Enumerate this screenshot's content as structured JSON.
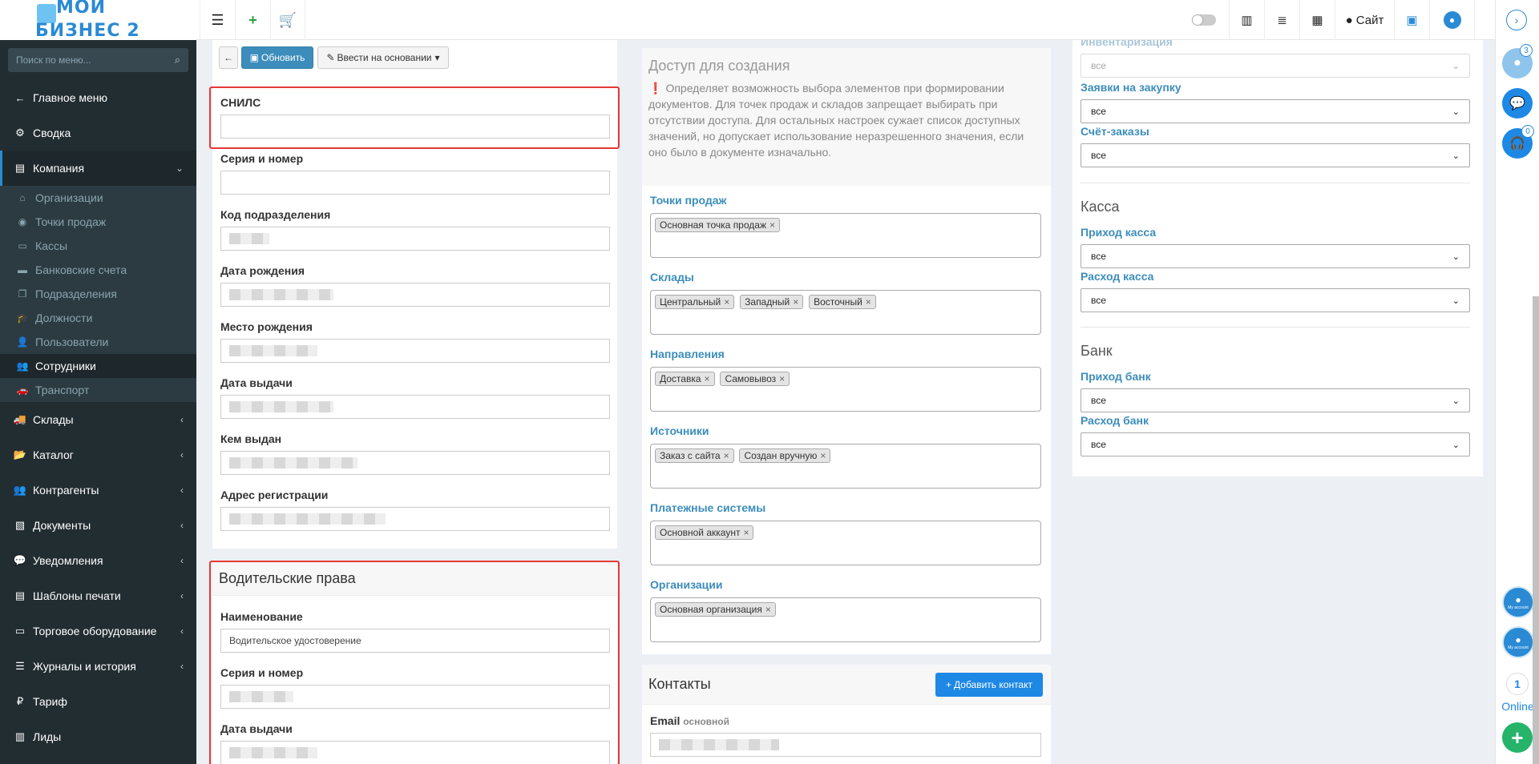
{
  "header": {
    "logo": {
      "line1": "МОЙ",
      "line2": "БИЗНЕС",
      "num": "2"
    },
    "site_label": "Сайт"
  },
  "sidebar": {
    "search_placeholder": "Поиск по меню...",
    "items": [
      {
        "label": "Главное меню",
        "icon": "arrow-left-icon"
      },
      {
        "label": "Сводка",
        "icon": "gear-icon"
      },
      {
        "label": "Компания",
        "icon": "chart-icon"
      },
      {
        "label": "Склады",
        "icon": "truck-icon"
      },
      {
        "label": "Каталог",
        "icon": "folder-icon"
      },
      {
        "label": "Контрагенты",
        "icon": "users-icon"
      },
      {
        "label": "Документы",
        "icon": "document-icon"
      },
      {
        "label": "Уведомления",
        "icon": "chat-icon"
      },
      {
        "label": "Шаблоны печати",
        "icon": "book-icon"
      },
      {
        "label": "Торговое оборудование",
        "icon": "hdd-icon"
      },
      {
        "label": "Журналы и история",
        "icon": "list-icon"
      },
      {
        "label": "Тариф",
        "icon": "ruble-icon"
      },
      {
        "label": "Лиды",
        "icon": "address-book-icon"
      }
    ],
    "company_sub": [
      {
        "label": "Организации",
        "icon": "bank-icon"
      },
      {
        "label": "Точки продаж",
        "icon": "circle-icon"
      },
      {
        "label": "Кассы",
        "icon": "register-icon"
      },
      {
        "label": "Банковские счета",
        "icon": "card-icon"
      },
      {
        "label": "Подразделения",
        "icon": "copy-icon"
      },
      {
        "label": "Должности",
        "icon": "graduation-icon"
      },
      {
        "label": "Пользователи",
        "icon": "user-icon"
      },
      {
        "label": "Сотрудники",
        "icon": "users-icon"
      },
      {
        "label": "Транспорт",
        "icon": "car-icon"
      }
    ]
  },
  "toolbar": {
    "refresh_label": "Обновить",
    "based_on_label": "Ввести на основании"
  },
  "left_panel": {
    "snils_label": "СНИЛС",
    "series_label": "Серия и номер",
    "division_code_label": "Код подразделения",
    "birth_date_label": "Дата рождения",
    "birth_place_label": "Место рождения",
    "issue_date_label": "Дата выдачи",
    "issued_by_label": "Кем выдан",
    "reg_address_label": "Адрес регистрации"
  },
  "license": {
    "title": "Водительские права",
    "name_label": "Наименование",
    "name_value": "Водительское удостоверение",
    "series_label": "Серия и номер",
    "issue_date_label": "Дата выдачи"
  },
  "access": {
    "title": "Доступ для создания",
    "help": "Определяет возможность выбора элементов при формировании документов. Для точек продаж и складов запрещает выбирать при отсутствии доступа. Для остальных настроек сужает список доступных значений, но допускает использование неразрешенного значения, если оно было в документе изначально.",
    "groups": [
      {
        "label": "Точки продаж",
        "tags": [
          "Основная точка продаж"
        ]
      },
      {
        "label": "Склады",
        "tags": [
          "Центральный",
          "Западный",
          "Восточный"
        ]
      },
      {
        "label": "Направления",
        "tags": [
          "Доставка",
          "Самовывоз"
        ]
      },
      {
        "label": "Источники",
        "tags": [
          "Заказ с сайта",
          "Создан вручную"
        ]
      },
      {
        "label": "Платежные системы",
        "tags": [
          "Основной аккаунт"
        ]
      },
      {
        "label": "Организации",
        "tags": [
          "Основная организация"
        ]
      }
    ]
  },
  "contacts": {
    "title": "Контакты",
    "add_label": "Добавить контакт",
    "email_label": "Email",
    "email_sub": "основной"
  },
  "right_panel": {
    "inventory_label": "Инвентаризация",
    "purchase_label": "Заявки на закупку",
    "invoice_label": "Счёт-заказы",
    "cash_title": "Касса",
    "cash_in_label": "Приход касса",
    "cash_out_label": "Расход касса",
    "bank_title": "Банк",
    "bank_in_label": "Приход банк",
    "bank_out_label": "Расход банк",
    "select_value": "все"
  },
  "rail": {
    "badge1": "3",
    "badge2": "0",
    "online_count": "1",
    "online_label": "Online",
    "account_label": "My account"
  }
}
